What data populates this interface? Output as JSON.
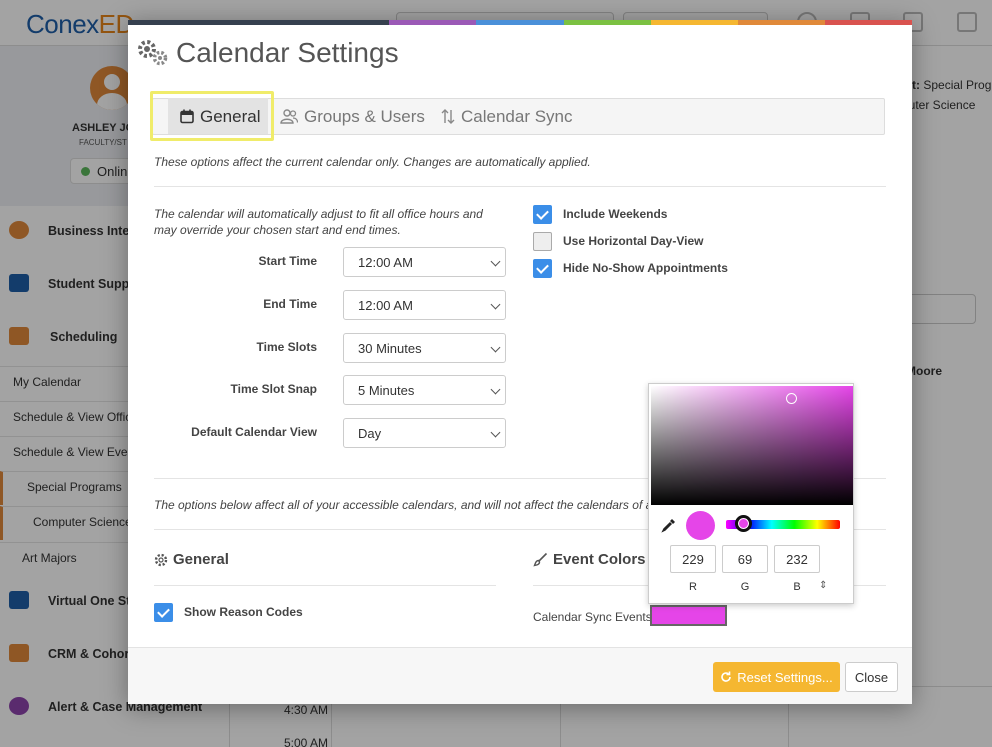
{
  "app": {
    "logo_part1": "Conex",
    "logo_part2": "ED",
    "profile_name": "ASHLEY JO",
    "profile_role": "FACULTY/ST",
    "status": "Onlin",
    "nav": [
      {
        "label": "Business Intell",
        "color": "#e0893a"
      },
      {
        "label": "Student Suppo",
        "color": "#1f5fa8"
      },
      {
        "label": "Scheduling",
        "color": "#e0893a"
      }
    ],
    "subnav": [
      "My Calendar",
      "Schedule & View Offic",
      "Schedule & View Even",
      "Special Programs",
      "Computer Science",
      "Art Majors"
    ],
    "nav_bottom": [
      {
        "label": "Virtual One Sto",
        "color": "#1f5fa8"
      },
      {
        "label": "CRM & Cohort",
        "color": "#e0893a"
      },
      {
        "label": "Alert & Case Management",
        "color": "#8e44ad"
      }
    ],
    "right_header_label": "t:",
    "right_header_value": "Special Prog",
    "right_header_sub": "puter Science",
    "right_column": "Moore",
    "times": [
      "4:30 AM",
      "5:00 AM"
    ]
  },
  "modal": {
    "title": "Calendar Settings",
    "rainbow": [
      "#36404f",
      "#36404f",
      "#36404f",
      "#9b59b6",
      "#4a90d9",
      "#7bc142",
      "#f5b731",
      "#e0893a",
      "#d9534f"
    ],
    "tabs": [
      {
        "label": "General",
        "icon": "calendar-icon",
        "active": true
      },
      {
        "label": "Groups & Users",
        "icon": "users-icon",
        "active": false
      },
      {
        "label": "Calendar Sync",
        "icon": "sync-arrows-icon",
        "active": false
      }
    ],
    "note_current": "These options affect the current calendar only. Changes are automatically applied.",
    "note_adjust": "The calendar will automatically adjust to fit all office hours and may override your chosen start and end times.",
    "fields": [
      {
        "label": "Start Time",
        "value": "12:00 AM"
      },
      {
        "label": "End Time",
        "value": "12:00 AM"
      },
      {
        "label": "Time Slots",
        "value": "30 Minutes"
      },
      {
        "label": "Time Slot Snap",
        "value": "5 Minutes"
      },
      {
        "label": "Default Calendar View",
        "value": "Day"
      }
    ],
    "checkboxes": [
      {
        "label": "Include Weekends",
        "checked": true
      },
      {
        "label": "Use Horizontal Day-View",
        "checked": false
      },
      {
        "label": "Hide No-Show Appointments",
        "checked": true
      }
    ],
    "note_all": "The options below affect all of your accessible calendars, and will not affect the calendars of a",
    "general_title": "General",
    "show_reason_codes": {
      "label": "Show Reason Codes",
      "checked": true
    },
    "event_colors_title": "Event Colors",
    "calendar_sync_label": "Calendar Sync Events",
    "calendar_sync_color": "#e545e8",
    "reset_label": "Reset Settings...",
    "close_label": "Close"
  },
  "picker": {
    "r": "229",
    "g": "69",
    "b": "232",
    "r_label": "R",
    "g_label": "G",
    "b_label": "B",
    "mode_toggle": "⇕"
  }
}
